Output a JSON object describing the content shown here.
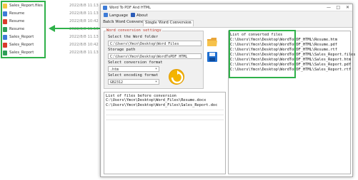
{
  "explorer": {
    "files": [
      {
        "name": "Sales_Report.files",
        "date": "2022/8/8 11:13",
        "icon": "folder-icon",
        "color": "#f2c744"
      },
      {
        "name": "Resume",
        "date": "2022/8/8 11:13",
        "icon": "html-file-icon",
        "color": "#3d7bd6"
      },
      {
        "name": "Resume",
        "date": "2022/8/8 10:42",
        "icon": "pdf-file-icon",
        "color": "#d93a2b"
      },
      {
        "name": "Resume",
        "date": "2022/8/8 11:13",
        "icon": "rtf-file-icon",
        "color": "#2e9d56"
      },
      {
        "name": "Sales_Report",
        "date": "2022/8/8 11:13",
        "icon": "html-file-icon",
        "color": "#3d7bd6"
      },
      {
        "name": "Sales_Report",
        "date": "2022/8/8 10:42",
        "icon": "pdf-file-icon",
        "color": "#d93a2b"
      },
      {
        "name": "Sales_Report",
        "date": "2022/8/8 11:13",
        "icon": "rtf-file-icon",
        "color": "#2e9d56"
      }
    ]
  },
  "window": {
    "title": "Word To PDF And HTML",
    "minimize": "—",
    "maximize": "□",
    "close": "✕"
  },
  "menu": {
    "language": "Language",
    "about": "About"
  },
  "tabs": {
    "batch": "Batch Word Conversion",
    "single": "Single Word Conversion"
  },
  "settings": {
    "legend": "Word conversion settings",
    "word_folder_label": "Select the Word folder",
    "word_folder_value": "C:\\Users\\Ymcn\\Desktop\\Word_Files",
    "storage_label": "Storage path",
    "storage_value": "C:\\Users\\Ymcn\\Desktop\\WordToPDF_HTML",
    "format_label": "Select conversion format",
    "format_value": ".htm",
    "encoding_label": "Select encoding format",
    "encoding_value": "GB2312"
  },
  "source_list": {
    "title": "List of files before conversion",
    "items": [
      "C:\\Users\\Ymcn\\Desktop\\Word_Files\\Resume.docx",
      "C:\\Users\\Ymcn\\Desktop\\Word_Files\\Sales_Report.doc"
    ]
  },
  "output_list": {
    "title": "List of converted files",
    "items": [
      "C:\\Users\\Ymcn\\Desktop\\WordToPDF_HTML\\Resume.htm",
      "C:\\Users\\Ymcn\\Desktop\\WordToPDF_HTML\\Resume.pdf",
      "C:\\Users\\Ymcn\\Desktop\\WordToPDF_HTML\\Resume.rtf",
      "C:\\Users\\Ymcn\\Desktop\\WordToPDF_HTML\\Sales_Report.files",
      "C:\\Users\\Ymcn\\Desktop\\WordToPDF_HTML\\Sales_Report.htm",
      "C:\\Users\\Ymcn\\Desktop\\WordToPDF_HTML\\Sales_Report.pdf",
      "C:\\Users\\Ymcn\\Desktop\\WordToPDF_HTML\\Sales_Report.rtf"
    ]
  },
  "colors": {
    "highlight": "#2fb14a",
    "legend_red": "#c0392b",
    "convert_button": "#f4b400"
  }
}
